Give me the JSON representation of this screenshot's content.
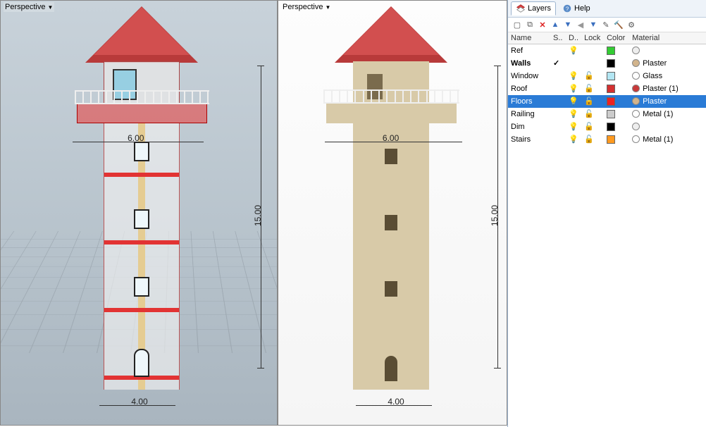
{
  "viewport_label": "Perspective",
  "dims": {
    "width": "4.00",
    "height": "15.00",
    "deck": "6.00"
  },
  "panel": {
    "tabs": [
      {
        "label": "Layers",
        "icon": "layers-icon"
      },
      {
        "label": "Help",
        "icon": "help-icon"
      }
    ],
    "columns": {
      "name": "Name",
      "col2": "S..",
      "col3": "D..",
      "lock": "Lock",
      "color": "Color",
      "material": "Material"
    },
    "layers": [
      {
        "name": "Ref",
        "checked": false,
        "on": "blue",
        "lock": false,
        "color": "#33cc33",
        "material": "",
        "matcolor": "#eee"
      },
      {
        "name": "Walls",
        "checked": true,
        "on": "off",
        "lock": false,
        "color": "#000000",
        "material": "Plaster",
        "matcolor": "#d2b48c"
      },
      {
        "name": "Window",
        "checked": false,
        "on": "on",
        "lock": true,
        "color": "#b3e6f3",
        "material": "Glass",
        "matcolor": "#ffffff"
      },
      {
        "name": "Roof",
        "checked": false,
        "on": "on",
        "lock": true,
        "color": "#d43030",
        "material": "Plaster (1)",
        "matcolor": "#c83a3a"
      },
      {
        "name": "Floors",
        "checked": false,
        "on": "on",
        "lock": true,
        "color": "#ee2222",
        "material": "Plaster",
        "matcolor": "#d2b48c",
        "selected": true
      },
      {
        "name": "Railing",
        "checked": false,
        "on": "on",
        "lock": true,
        "color": "#cccccc",
        "material": "Metal (1)",
        "matcolor": "#ffffff"
      },
      {
        "name": "Dim",
        "checked": false,
        "on": "on",
        "lock": true,
        "color": "#000000",
        "material": "",
        "matcolor": "#eee"
      },
      {
        "name": "Stairs",
        "checked": false,
        "on": "on",
        "lock": true,
        "color": "#ff9a1f",
        "material": "Metal (1)",
        "matcolor": "#ffffff"
      }
    ]
  }
}
